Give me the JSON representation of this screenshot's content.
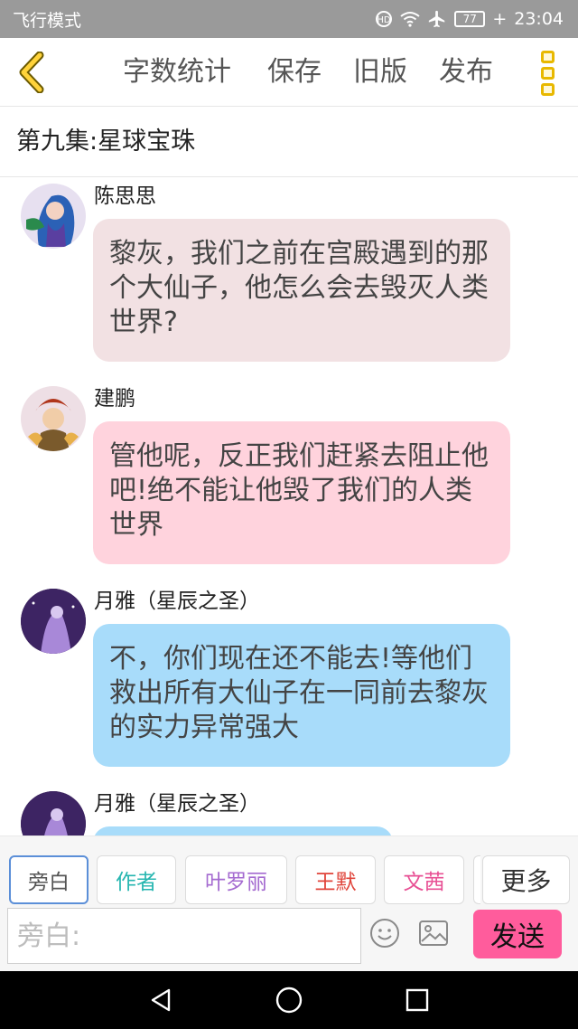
{
  "status_bar": {
    "mode_label": "飞行模式",
    "battery": "77",
    "time": "23:04",
    "icons": [
      "lte-call-icon",
      "wifi-icon",
      "airplane-icon",
      "battery-icon",
      "charging-icon"
    ]
  },
  "toolbar": {
    "word_count": "字数统计",
    "save": "保存",
    "old_version": "旧版",
    "publish": "发布",
    "accent_color": "#e8b800"
  },
  "episode": {
    "title": "第九集:星球宝珠"
  },
  "messages": [
    {
      "speaker": "陈思思",
      "text": "黎灰，我们之前在宫殿遇到的那个大仙子，他怎么会去毁灭人类世界?",
      "bubble_color": "#f2e1e3"
    },
    {
      "speaker": "建鹏",
      "text": "管他呢，反正我们赶紧去阻止他吧!绝不能让他毁了我们的人类世界",
      "bubble_color": "#ffd3dd"
    },
    {
      "speaker": "月雅（星辰之圣）",
      "text": "不，你们现在还不能去!等他们救出所有大仙子在一同前去黎灰的实力异常强大",
      "bubble_color": "#a8dcfa"
    },
    {
      "speaker": "月雅（星辰之圣）",
      "text": "",
      "bubble_color": "#a8dcfa"
    }
  ],
  "role_tags": [
    {
      "label": "旁白",
      "color": "#555555"
    },
    {
      "label": "作者",
      "color": "#26b6b0"
    },
    {
      "label": "叶罗丽",
      "color": "#a46ad0"
    },
    {
      "label": "王默",
      "color": "#e0443a"
    },
    {
      "label": "文茜",
      "color": "#e85094"
    },
    {
      "label": "更多",
      "color": "#333333"
    }
  ],
  "input": {
    "placeholder": "旁白:",
    "send": "发送"
  },
  "nav": {
    "icons": [
      "back-triangle-icon",
      "home-circle-icon",
      "recents-square-icon"
    ]
  }
}
